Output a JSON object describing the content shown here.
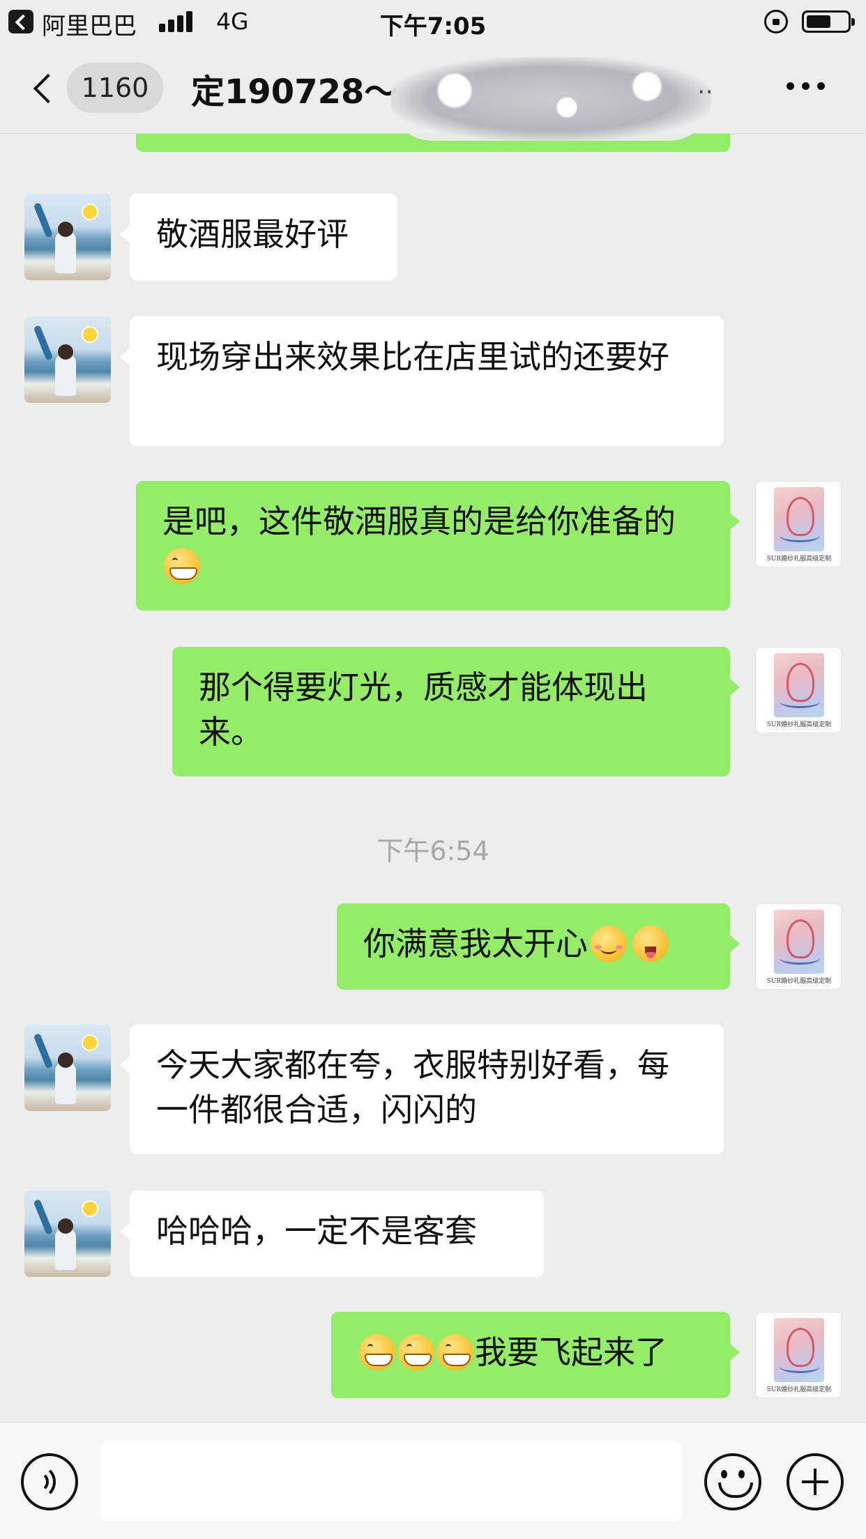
{
  "status_bar": {
    "back_app": "阿里巴巴",
    "network": "4G",
    "time": "下午7:05"
  },
  "nav": {
    "unread_count": "1160",
    "title": "定190728～",
    "title_suffix": ".."
  },
  "messages": [
    {
      "from": "them",
      "text": "敬酒服最好评"
    },
    {
      "from": "them",
      "text": "现场穿出来效果比在店里试的还要好"
    },
    {
      "from": "me",
      "text": "是吧，这件敬酒服真的是给你准备的",
      "emoji": [
        "grin"
      ]
    },
    {
      "from": "me",
      "text": "那个得要灯光，质感才能体现出来。"
    },
    {
      "divider": "下午6:54"
    },
    {
      "from": "me",
      "text": "你满意我太开心",
      "emoji": [
        "smile",
        "wink"
      ]
    },
    {
      "from": "them",
      "text": "今天大家都在夸，衣服特别好看，每一件都很合适，闪闪的"
    },
    {
      "from": "them",
      "text": "哈哈哈，一定不是客套"
    },
    {
      "from": "me",
      "text": "我要飞起来了",
      "emoji_before": [
        "grin",
        "grin",
        "grin"
      ]
    }
  ],
  "colors": {
    "background": "#ededed",
    "my_bubble": "#95ec69",
    "their_bubble": "#ffffff",
    "divider_text": "#a8a8a8"
  },
  "icons": {
    "nav_back": "chevron-left-icon",
    "nav_more": "more-horizontal-icon",
    "voice": "voice-icon",
    "emoji": "smile-face-icon",
    "plus": "plus-circle-icon"
  }
}
